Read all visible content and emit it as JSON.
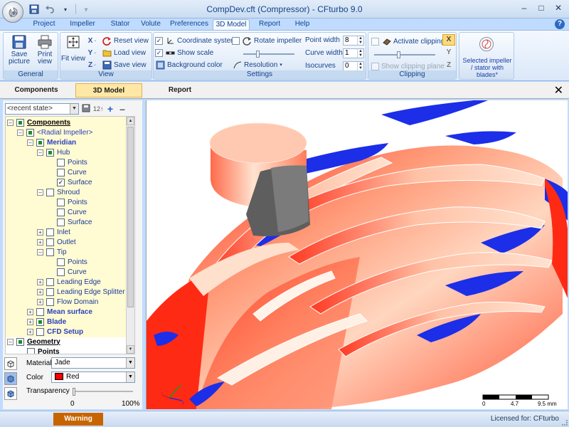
{
  "window": {
    "title": "CompDev.cft (Compressor) - CFturbo 9.0"
  },
  "ribbon_tabs": [
    "Project",
    "Impeller",
    "Stator",
    "Volute",
    "Preferences",
    "3D Model",
    "Report",
    "Help"
  ],
  "active_ribbon_tab": "3D Model",
  "groups": {
    "general": {
      "label": "General",
      "save_picture": "Save picture",
      "print_view": "Print view"
    },
    "view": {
      "label": "View",
      "fit_view": "Fit view",
      "reset_view": "Reset view",
      "load_view": "Load view",
      "save_view": "Save view",
      "axis_x": "X",
      "axis_y": "Y",
      "axis_z": "Z"
    },
    "settings": {
      "label": "Settings",
      "coordinate_system": "Coordinate system",
      "show_scale": "Show scale",
      "background_color": "Background color",
      "rotate_impeller": "Rotate impeller",
      "resolution": "Resolution",
      "point_width_label": "Point width",
      "point_width_value": "8",
      "curve_width_label": "Curve width",
      "curve_width_value": "1",
      "isocurves_label": "Isocurves",
      "isocurves_value": "0"
    },
    "clipping": {
      "label": "Clipping",
      "activate_clipping": "Activate clipping",
      "show_clipping_plane": "Show clipping plane"
    },
    "selected": {
      "label": "Selected impeller / stator with blades*"
    }
  },
  "panel_tabs": [
    "Components",
    "3D Model",
    "Report"
  ],
  "active_panel_tab": "3D Model",
  "state": {
    "recent_state": "<recent state>"
  },
  "tree": [
    {
      "label": "Components",
      "style": "root"
    },
    {
      "label": "<Radial Impeller>",
      "style": "blue"
    },
    {
      "label": "Meridian",
      "style": "bold"
    },
    {
      "label": "Hub",
      "style": "link"
    },
    {
      "label": "Points",
      "style": "link"
    },
    {
      "label": "Curve",
      "style": "link"
    },
    {
      "label": "Surface",
      "style": "link"
    },
    {
      "label": "Shroud",
      "style": "link"
    },
    {
      "label": "Points",
      "style": "link"
    },
    {
      "label": "Curve",
      "style": "link"
    },
    {
      "label": "Surface",
      "style": "link"
    },
    {
      "label": "Inlet",
      "style": "link"
    },
    {
      "label": "Outlet",
      "style": "link"
    },
    {
      "label": "Tip",
      "style": "link"
    },
    {
      "label": "Points",
      "style": "link"
    },
    {
      "label": "Curve",
      "style": "link"
    },
    {
      "label": "Leading Edge",
      "style": "link"
    },
    {
      "label": "Leading Edge Splitter",
      "style": "link"
    },
    {
      "label": "Flow Domain",
      "style": "link"
    },
    {
      "label": "Mean surface",
      "style": "bold"
    },
    {
      "label": "Blade",
      "style": "bold"
    },
    {
      "label": "CFD Setup",
      "style": "bold"
    },
    {
      "label": "Geometry",
      "style": "root"
    },
    {
      "label": "Points",
      "style": "plainbold"
    }
  ],
  "properties": {
    "material_label": "Material",
    "material_value": "Jade",
    "color_label": "Color",
    "color_value": "Red",
    "color_hex": "#ff0000",
    "transparency_label": "Transparency",
    "transparency_min": "0",
    "transparency_max": "100%",
    "transparency_value": 0
  },
  "scale": {
    "labels": [
      "0",
      "4.7",
      "9.5 mm"
    ]
  },
  "status": {
    "warning": "Warning",
    "license": "Licensed for: CFturbo"
  },
  "colors": {
    "accent": "#2b3fbd",
    "warning": "#c86400",
    "tree_bg": "#fffbd2",
    "surface_red": "#ff2a1a",
    "surface_blue": "#1c2ee8"
  }
}
